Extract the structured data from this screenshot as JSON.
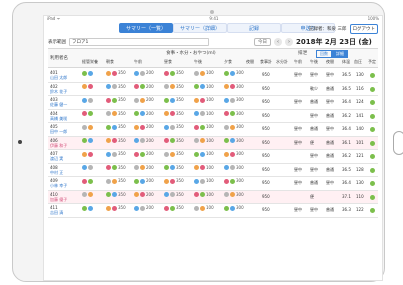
{
  "status": {
    "left": "iPad ᯤ",
    "center": "9:41",
    "right": "100%"
  },
  "tabs": [
    {
      "label": "サマリー（一覧）",
      "active": true
    },
    {
      "label": "サマリー（詳細）",
      "active": false
    },
    {
      "label": "記録",
      "active": false
    },
    {
      "label": "申送り",
      "active": false
    }
  ],
  "record": {
    "user": "記録者：和泉 三郎",
    "logout": "ログアウト"
  },
  "filter": {
    "label": "表示範囲",
    "value": "フロア1"
  },
  "nav": {
    "today": "今日",
    "prev": "‹",
    "next": "›",
    "date": "2018年 2月 23日 (金)"
  },
  "header": {
    "group": "食事・水分・おやつ(ml)",
    "name_col": "利用者名",
    "bunrui": "経管栄養",
    "asa": "朝食",
    "gozen": "午前",
    "hiru": "昼食",
    "gogo": "午後",
    "yu": "夕食",
    "yakan": "夜間",
    "shoku": "食事計",
    "suibun": "水分計",
    "haisetsu": "排泄",
    "toggle_a": "回数",
    "toggle_b": "詳細",
    "gozen2": "午前",
    "gogo2": "午後",
    "yakan2": "夜間",
    "tai": "体温",
    "ketsu": "血圧",
    "yotei": "予定"
  },
  "residents": [
    {
      "room": "401",
      "name": "山田 太郎",
      "pink": false,
      "v1": "350",
      "v2": "200",
      "v3": "350",
      "v4": "100",
      "v5": "300",
      "shoku": "950",
      "h1": "昼中",
      "h2": "昼中",
      "h3": "昼中",
      "temp": "36.5",
      "bp": "130"
    },
    {
      "room": "402",
      "name": "鈴木 花子",
      "pink": false,
      "v1": "350",
      "v2": "200",
      "v3": "350",
      "v4": "100",
      "v5": "300",
      "shoku": "950",
      "h1": "",
      "h2": "軟少",
      "h3": "普通",
      "temp": "36.5",
      "bp": "116"
    },
    {
      "room": "403",
      "name": "佐藤 健一",
      "pink": false,
      "v1": "350",
      "v2": "200",
      "v3": "350",
      "v4": "100",
      "v5": "300",
      "shoku": "950",
      "h1": "昼中",
      "h2": "普通",
      "h3": "昼中",
      "temp": "36.4",
      "bp": "124"
    },
    {
      "room": "404",
      "name": "高橋 美咲",
      "pink": false,
      "v1": "350",
      "v2": "200",
      "v3": "350",
      "v4": "100",
      "v5": "300",
      "shoku": "950",
      "h1": "",
      "h2": "昼中",
      "h3": "普通",
      "temp": "36.2",
      "bp": "141"
    },
    {
      "room": "405",
      "name": "田中 一郎",
      "pink": false,
      "v1": "350",
      "v2": "200",
      "v3": "350",
      "v4": "100",
      "v5": "300",
      "shoku": "950",
      "h1": "昼中",
      "h2": "普通",
      "h3": "昼中",
      "temp": "36.4",
      "bp": "140"
    },
    {
      "room": "406",
      "name": "伊藤 和子",
      "pink": true,
      "v1": "350",
      "v2": "200",
      "v3": "350",
      "v4": "100",
      "v5": "300",
      "shoku": "950",
      "h1": "昼中",
      "h2": "便",
      "h3": "普通",
      "temp": "36.1",
      "bp": "101"
    },
    {
      "room": "407",
      "name": "渡辺 実",
      "pink": false,
      "v1": "350",
      "v2": "200",
      "v3": "350",
      "v4": "100",
      "v5": "300",
      "shoku": "950",
      "h1": "",
      "h2": "昼中",
      "h3": "普通",
      "temp": "36.2",
      "bp": "121"
    },
    {
      "room": "408",
      "name": "中村 正",
      "pink": false,
      "v1": "350",
      "v2": "200",
      "v3": "350",
      "v4": "100",
      "v5": "300",
      "shoku": "950",
      "h1": "昼中",
      "h2": "昼中",
      "h3": "普通",
      "temp": "36.5",
      "bp": "128"
    },
    {
      "room": "409",
      "name": "小林 幸子",
      "pink": false,
      "v1": "350",
      "v2": "200",
      "v3": "350",
      "v4": "100",
      "v5": "300",
      "shoku": "950",
      "h1": "昼中",
      "h2": "普通",
      "h3": "昼中",
      "temp": "36.4",
      "bp": "130"
    },
    {
      "room": "410",
      "name": "加藤 優子",
      "pink": true,
      "v1": "350",
      "v2": "200",
      "v3": "350",
      "v4": "100",
      "v5": "300",
      "shoku": "950",
      "h1": "",
      "h2": "便",
      "h3": "",
      "temp": "37.1",
      "bp": "110"
    },
    {
      "room": "411",
      "name": "吉田 清",
      "pink": false,
      "v1": "350",
      "v2": "200",
      "v3": "350",
      "v4": "100",
      "v5": "300",
      "shoku": "950",
      "h1": "昼中",
      "h2": "昼中",
      "h3": "普通",
      "temp": "36.3",
      "bp": "122"
    }
  ]
}
